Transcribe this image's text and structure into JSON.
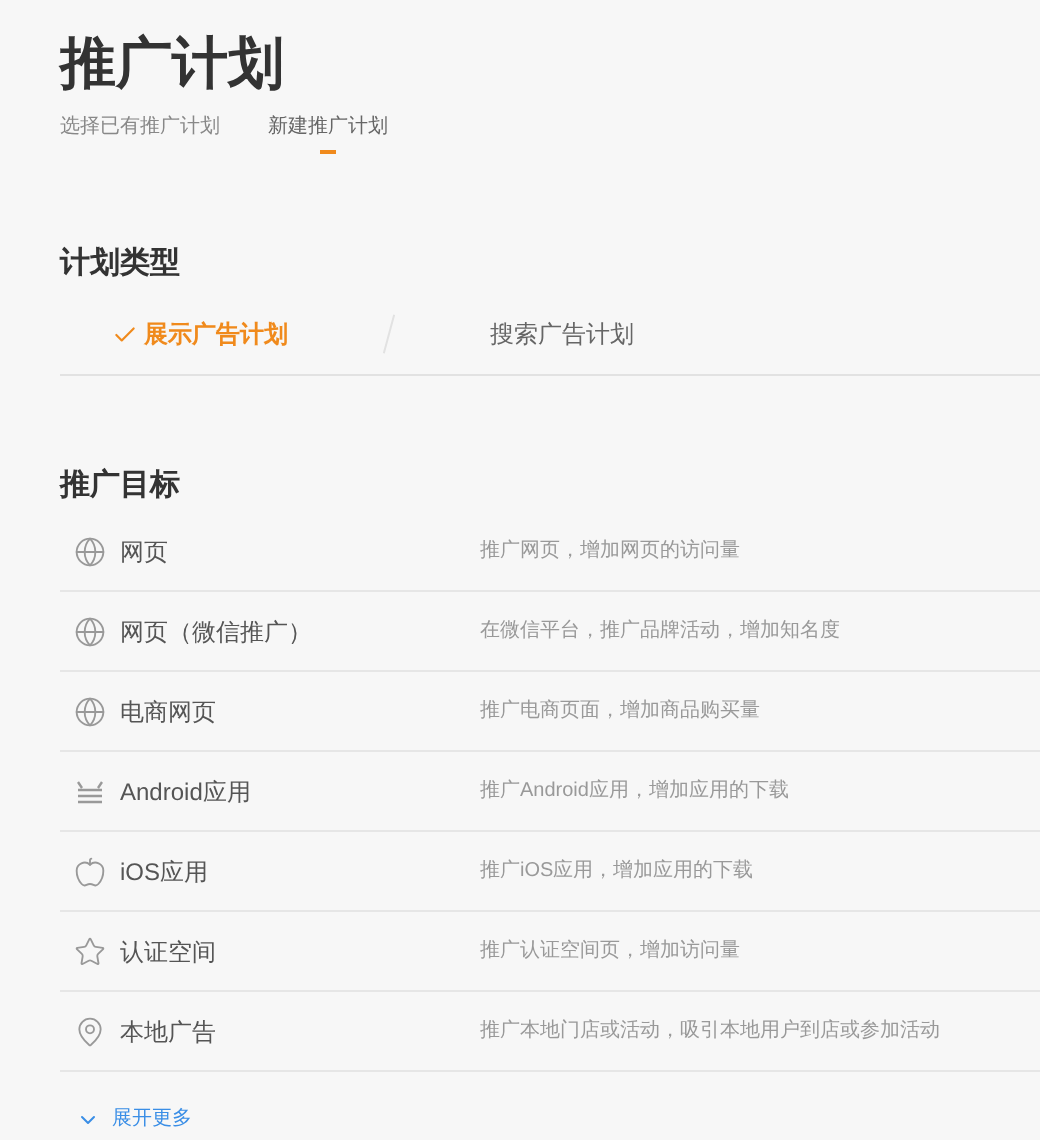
{
  "title": "推广计划",
  "tabs": [
    {
      "label": "选择已有推广计划",
      "selected": false
    },
    {
      "label": "新建推广计划",
      "selected": true
    }
  ],
  "plan_type": {
    "heading": "计划类型",
    "options": [
      {
        "label": "展示广告计划",
        "selected": true
      },
      {
        "label": "搜索广告计划",
        "selected": false
      }
    ]
  },
  "goal": {
    "heading": "推广目标",
    "items": [
      {
        "kind": "web",
        "label": "网页",
        "description": "推广网页，增加网页的访问量"
      },
      {
        "kind": "web",
        "label": "网页（微信推广）",
        "description": "在微信平台，推广品牌活动，增加知名度"
      },
      {
        "kind": "web",
        "label": "电商网页",
        "description": "推广电商页面，增加商品购买量"
      },
      {
        "kind": "android",
        "label": "Android应用",
        "description": "推广Android应用，增加应用的下载"
      },
      {
        "kind": "ios",
        "label": "iOS应用",
        "description": "推广iOS应用，增加应用的下载"
      },
      {
        "kind": "space",
        "label": "认证空间",
        "description": "推广认证空间页，增加访问量"
      },
      {
        "kind": "local",
        "label": "本地广告",
        "description": "推广本地门店或活动，吸引本地用户到店或参加活动"
      }
    ],
    "more": "展开更多"
  }
}
